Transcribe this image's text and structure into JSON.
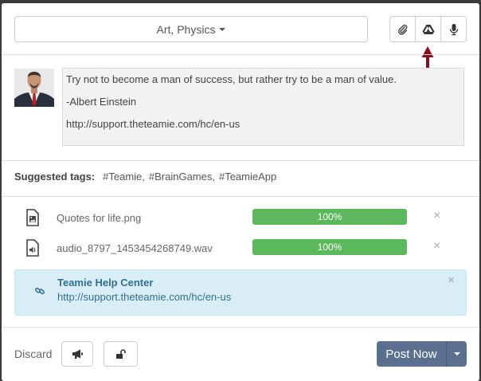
{
  "header": {
    "group_selector_label": "Art, Physics",
    "tools": [
      {
        "icon": "paperclip-icon"
      },
      {
        "icon": "google-drive-icon"
      },
      {
        "icon": "microphone-icon"
      }
    ]
  },
  "post": {
    "lines": [
      "Try not to become a man of success, but rather try to be a man of value.",
      "-Albert Einstein",
      "http://support.theteamie.com/hc/en-us"
    ]
  },
  "tags": {
    "label": "Suggested tags:",
    "items": [
      "#Teamie,",
      "#BrainGames,",
      "#TeamieApp"
    ]
  },
  "attachments": [
    {
      "name": "Quotes for life.png",
      "icon": "image-file-icon",
      "progress_label": "100%",
      "progress": 1.0
    },
    {
      "name": "audio_8797_1453454268749.wav",
      "icon": "audio-file-icon",
      "progress_label": "100%",
      "progress": 1.0
    }
  ],
  "link_preview": {
    "title": "Teamie Help Center",
    "url": "http://support.theteamie.com/hc/en-us"
  },
  "footer": {
    "discard_label": "Discard",
    "post_label": "Post Now"
  },
  "colors": {
    "progress": "#5cb85c",
    "link_card_bg": "#d9edf7",
    "post_button": "#5b6f8e",
    "arrow": "#8b0d1a"
  }
}
